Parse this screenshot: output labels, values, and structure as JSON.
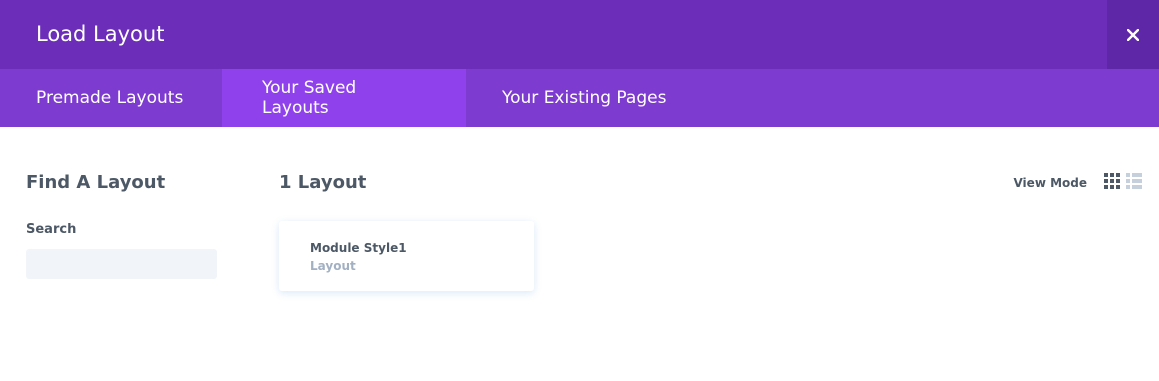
{
  "header": {
    "title": "Load Layout",
    "close_icon": "close-icon",
    "background": "#6c2eb9"
  },
  "tabs": [
    {
      "label": "Premade Layouts",
      "active": false
    },
    {
      "label": "Your Saved Layouts",
      "active": true
    },
    {
      "label": "Your Existing Pages",
      "active": false
    }
  ],
  "sidebar": {
    "title": "Find A Layout",
    "search_label": "Search",
    "search_value": "",
    "search_placeholder": ""
  },
  "main": {
    "count_label": "1 Layout",
    "view_mode_label": "View Mode",
    "view_modes": [
      {
        "icon": "grid-view-icon",
        "active": true
      },
      {
        "icon": "list-view-icon",
        "active": false
      }
    ],
    "layouts": [
      {
        "title": "Module Style1",
        "type": "Layout"
      }
    ]
  },
  "colors": {
    "tab_bar": "#7e3bd0",
    "tab_active": "#8f42ec",
    "text": "#4c5866",
    "muted": "#a3b0c2",
    "input_bg": "#f1f5f9"
  }
}
